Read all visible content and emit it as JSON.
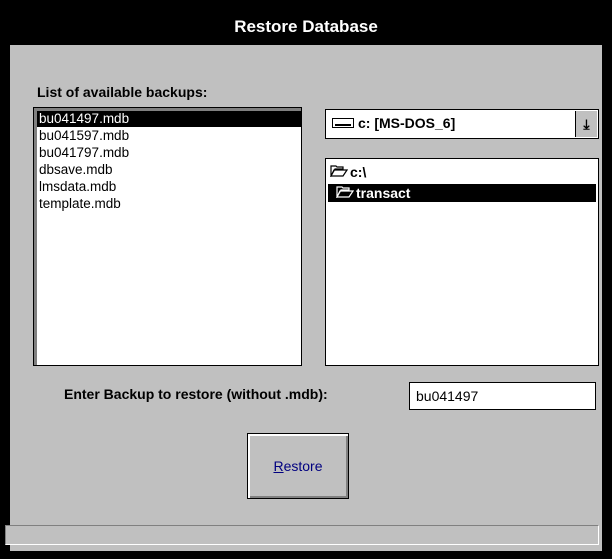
{
  "window": {
    "title": "Restore Database"
  },
  "backups": {
    "label": "List of available backups:",
    "items": [
      "bu041497.mdb",
      "bu041597.mdb",
      "bu041797.mdb",
      "dbsave.mdb",
      "lmsdata.mdb",
      "template.mdb"
    ],
    "selected_index": 0
  },
  "drive": {
    "value": "c: [MS-DOS_6]",
    "icon": "drive-icon",
    "dropdown_icon": "arrow-down-icon"
  },
  "directories": {
    "items": [
      {
        "label": "c:\\",
        "icon": "open-folder-icon"
      },
      {
        "label": "transact",
        "icon": "open-folder-icon"
      }
    ],
    "selected_index": 1
  },
  "restore_input": {
    "label": "Enter Backup to restore (without .mdb):",
    "value": "bu041497"
  },
  "restore_button": {
    "label_accel": "R",
    "label_rest": "estore"
  },
  "status_bar": {
    "text": ""
  }
}
